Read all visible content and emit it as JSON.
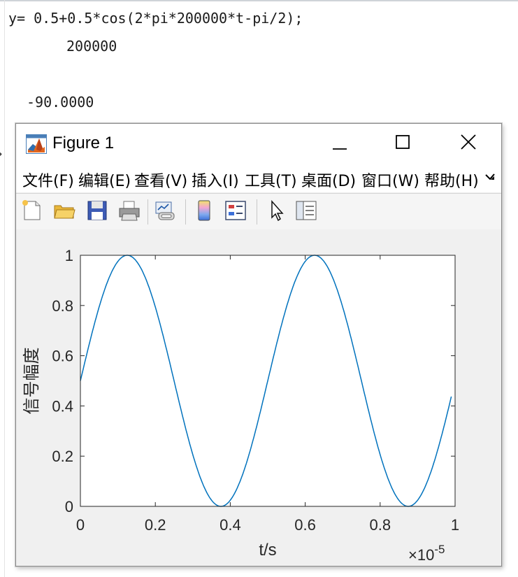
{
  "command_window": {
    "line1": "y= 0.5+0.5*cos(2*pi*200000*t-pi/2);",
    "line2": "200000",
    "line3": "-90.0000"
  },
  "figure": {
    "title": "Figure 1",
    "menu": [
      "文件(F)",
      "编辑(E)",
      "查看(V)",
      "插入(I)",
      "工具(T)",
      "桌面(D)",
      "窗口(W)",
      "帮助(H)"
    ],
    "toolbar_icons": [
      "new-figure-icon",
      "open-file-icon",
      "save-icon",
      "print-icon",
      "link-plot-icon",
      "colorbar-icon",
      "legend-icon",
      "pointer-icon",
      "property-inspector-icon"
    ]
  },
  "chart_data": {
    "type": "line",
    "title": "",
    "xlabel": "t/s",
    "ylabel": "信号幅度",
    "x_exponent_label": "×10",
    "x_exponent_power": "-5",
    "xlim": [
      0,
      1
    ],
    "ylim": [
      0,
      1
    ],
    "xticks": [
      "0",
      "0.2",
      "0.4",
      "0.6",
      "0.8",
      "1"
    ],
    "yticks": [
      "0",
      "0.2",
      "0.4",
      "0.6",
      "0.8",
      "1"
    ],
    "series": [
      {
        "color": "#0072BD",
        "x": [
          0,
          0.05,
          0.1,
          0.125,
          0.15,
          0.2,
          0.25,
          0.3,
          0.35,
          0.375,
          0.4,
          0.45,
          0.5,
          0.55,
          0.6,
          0.625,
          0.65,
          0.7,
          0.75,
          0.8,
          0.85,
          0.875,
          0.9,
          0.95,
          0.99
        ],
        "y": [
          0.5,
          0.81,
          0.98,
          1.0,
          0.98,
          0.81,
          0.5,
          0.19,
          0.02,
          0.0,
          0.02,
          0.19,
          0.5,
          0.81,
          0.98,
          1.0,
          0.98,
          0.81,
          0.5,
          0.19,
          0.02,
          0.0,
          0.02,
          0.19,
          0.44
        ]
      }
    ],
    "grid": false
  }
}
